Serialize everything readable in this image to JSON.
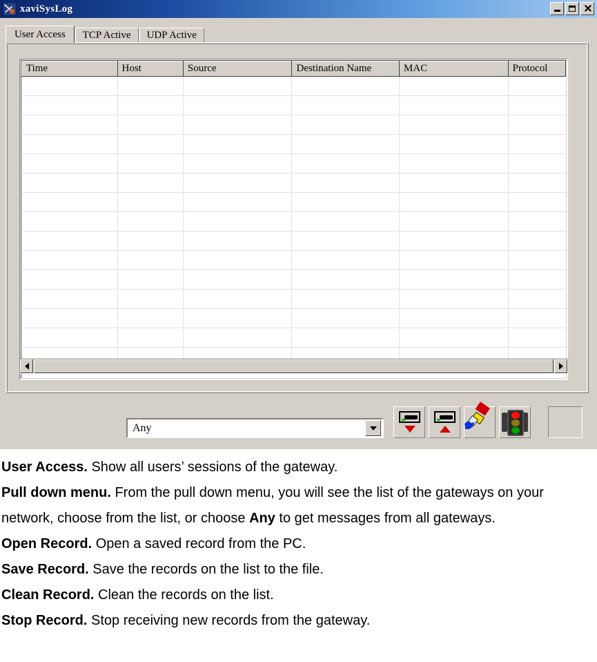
{
  "window": {
    "title": "xaviSysLog",
    "app_icon": "scissors-icon",
    "controls": [
      {
        "name": "minimize",
        "glyph": "minimize-icon"
      },
      {
        "name": "maximize",
        "glyph": "maximize-icon"
      },
      {
        "name": "close",
        "glyph": "close-icon"
      }
    ]
  },
  "tabs": [
    {
      "label": "User Access",
      "active": true
    },
    {
      "label": "TCP Active",
      "active": false
    },
    {
      "label": "UDP Active",
      "active": false
    }
  ],
  "grid": {
    "columns": [
      "Time",
      "Host",
      "Source",
      "Destination Name",
      "MAC",
      "Protocol"
    ],
    "rows": [],
    "empty_row_count": 15
  },
  "scrollbar": {
    "left_arrow": "arrow-left-icon",
    "right_arrow": "arrow-right-icon"
  },
  "gateway_filter": {
    "value": "Any",
    "options": [
      "Any"
    ],
    "dropdown_icon": "chevron-down-icon"
  },
  "toolbar": {
    "buttons": [
      {
        "name": "open-record",
        "icon": "drive-down-arrow-icon",
        "label": "Open Record"
      },
      {
        "name": "save-record",
        "icon": "drive-up-arrow-icon",
        "label": "Save Record"
      },
      {
        "name": "clean-record",
        "icon": "paintbrush-icon",
        "label": "Clean Record"
      },
      {
        "name": "stop-record",
        "icon": "traffic-light-icon",
        "label": "Stop Record"
      }
    ]
  },
  "status_panel": {
    "value": ""
  },
  "documentation": [
    {
      "term": "User Access.",
      "text": " Show all users’ sessions of the gateway."
    },
    {
      "term": "Pull down menu.",
      "text": " From the pull down menu, you will see the list of the gateways on your network, choose from the list, or choose ",
      "emphasis": "Any",
      "text2": " to get messages from all gateways."
    },
    {
      "term": "Open Record.",
      "text": " Open a saved record from the PC."
    },
    {
      "term": "Save Record.",
      "text": " Save the records on the list to the file."
    },
    {
      "term": "Clean Record.",
      "text": " Clean the records on the list."
    },
    {
      "term": "Stop Record.",
      "text": " Stop receiving new records from the gateway."
    }
  ],
  "colors": {
    "titlebar_start": "#0a246a",
    "titlebar_end": "#a6caf0",
    "face": "#d4d0c8",
    "grid_line": "#e3e1dc",
    "arrow_red": "#d00000",
    "light_red": "#ff1010",
    "light_amber": "#8a7a10",
    "light_green": "#00a000"
  }
}
